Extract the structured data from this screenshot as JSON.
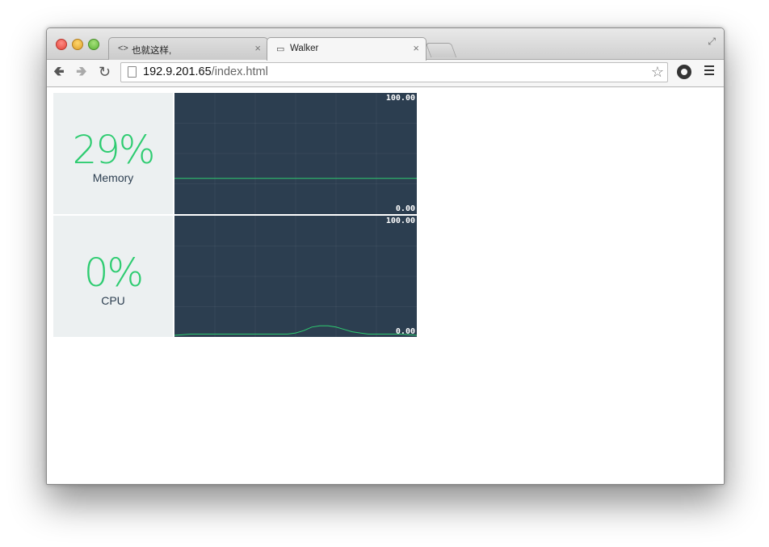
{
  "browser": {
    "tabs": [
      {
        "icon": "code-icon",
        "title": "也就这样,",
        "close": "×"
      },
      {
        "icon": "page-icon",
        "title": "Walker",
        "close": "×"
      }
    ],
    "address": {
      "host": "192.9.201.65",
      "path": "/index.html"
    }
  },
  "colors": {
    "accent_green": "#2ecc71",
    "panel_bg": "#ecf0f1",
    "graph_bg": "#2c3e50"
  },
  "panels": [
    {
      "value": "29%",
      "label": "Memory",
      "ymax": "100.00",
      "ymin": "0.00"
    },
    {
      "value": "0%",
      "label": "CPU",
      "ymax": "100.00",
      "ymin": "0.00"
    }
  ],
  "chart_data": [
    {
      "type": "line",
      "ylim": [
        0,
        100
      ],
      "tick_labels": [
        "100.00",
        "0.00"
      ],
      "grid": true,
      "series": [
        {
          "values": [
            29,
            29,
            29,
            29,
            29,
            29,
            29,
            29,
            29,
            29,
            29,
            29,
            29,
            29,
            29,
            29,
            29,
            29,
            29,
            29,
            29,
            29,
            29,
            29,
            29,
            29,
            29,
            29,
            29,
            29,
            29
          ]
        }
      ]
    },
    {
      "type": "line",
      "ylim": [
        0,
        100
      ],
      "tick_labels": [
        "100.00",
        "0.00"
      ],
      "grid": true,
      "series": [
        {
          "values": [
            0,
            0.5,
            1,
            1,
            1,
            1,
            1,
            1,
            1,
            1,
            1,
            1,
            1,
            1,
            1,
            2,
            4,
            7,
            8,
            8,
            7,
            5,
            3,
            2,
            1,
            1,
            1,
            1,
            1,
            0.5,
            0
          ]
        }
      ]
    }
  ]
}
